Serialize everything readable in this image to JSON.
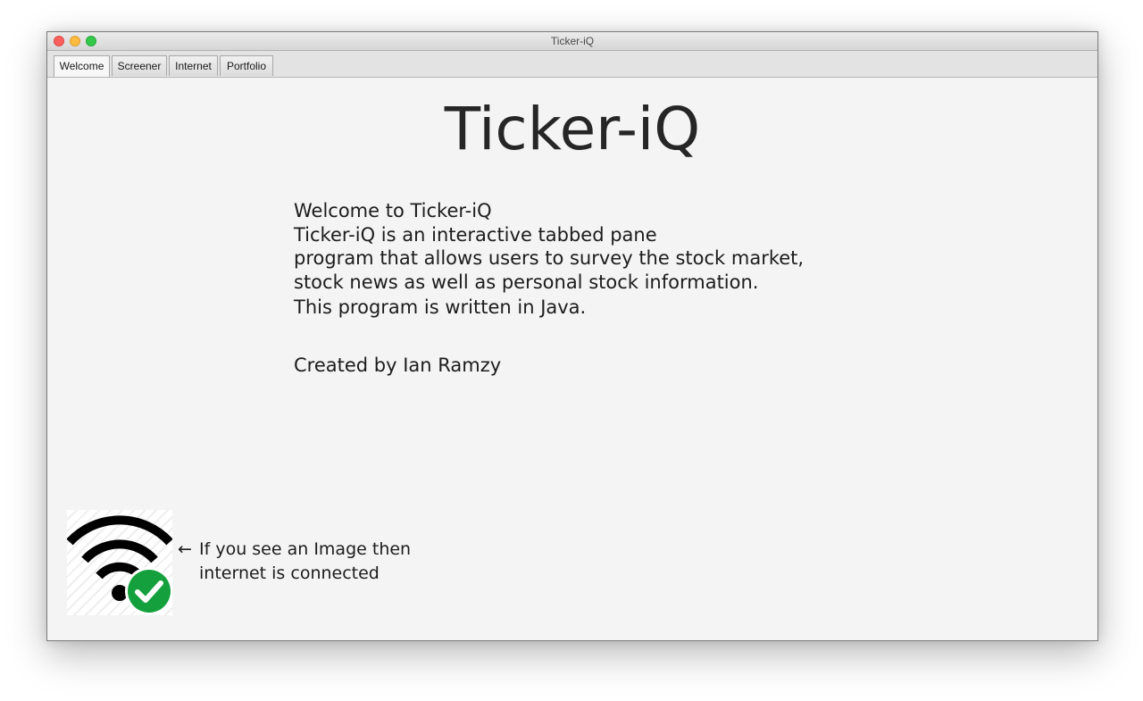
{
  "window": {
    "title": "Ticker-iQ"
  },
  "tabs": [
    {
      "label": "Welcome",
      "active": true
    },
    {
      "label": "Screener",
      "active": false
    },
    {
      "label": "Internet",
      "active": false
    },
    {
      "label": "Portfolio",
      "active": false
    }
  ],
  "welcome": {
    "heading": "Ticker-iQ",
    "lines": [
      "Welcome to Ticker-iQ",
      "Ticker-iQ is an interactive tabbed pane",
      "program that allows users to survey the stock market,",
      "stock news as well as personal stock information.",
      "This program is written in Java."
    ],
    "credit": "Created by Ian Ramzy"
  },
  "internet_status": {
    "icon": "wifi-connected-icon",
    "arrow": "←",
    "note_line1": "If you see an Image then",
    "note_line2": "internet is connected"
  },
  "colors": {
    "close": "#fc605c",
    "minimize": "#fdbc40",
    "maximize": "#34c84a",
    "check_green": "#14a03c",
    "wifi_black": "#000000"
  }
}
